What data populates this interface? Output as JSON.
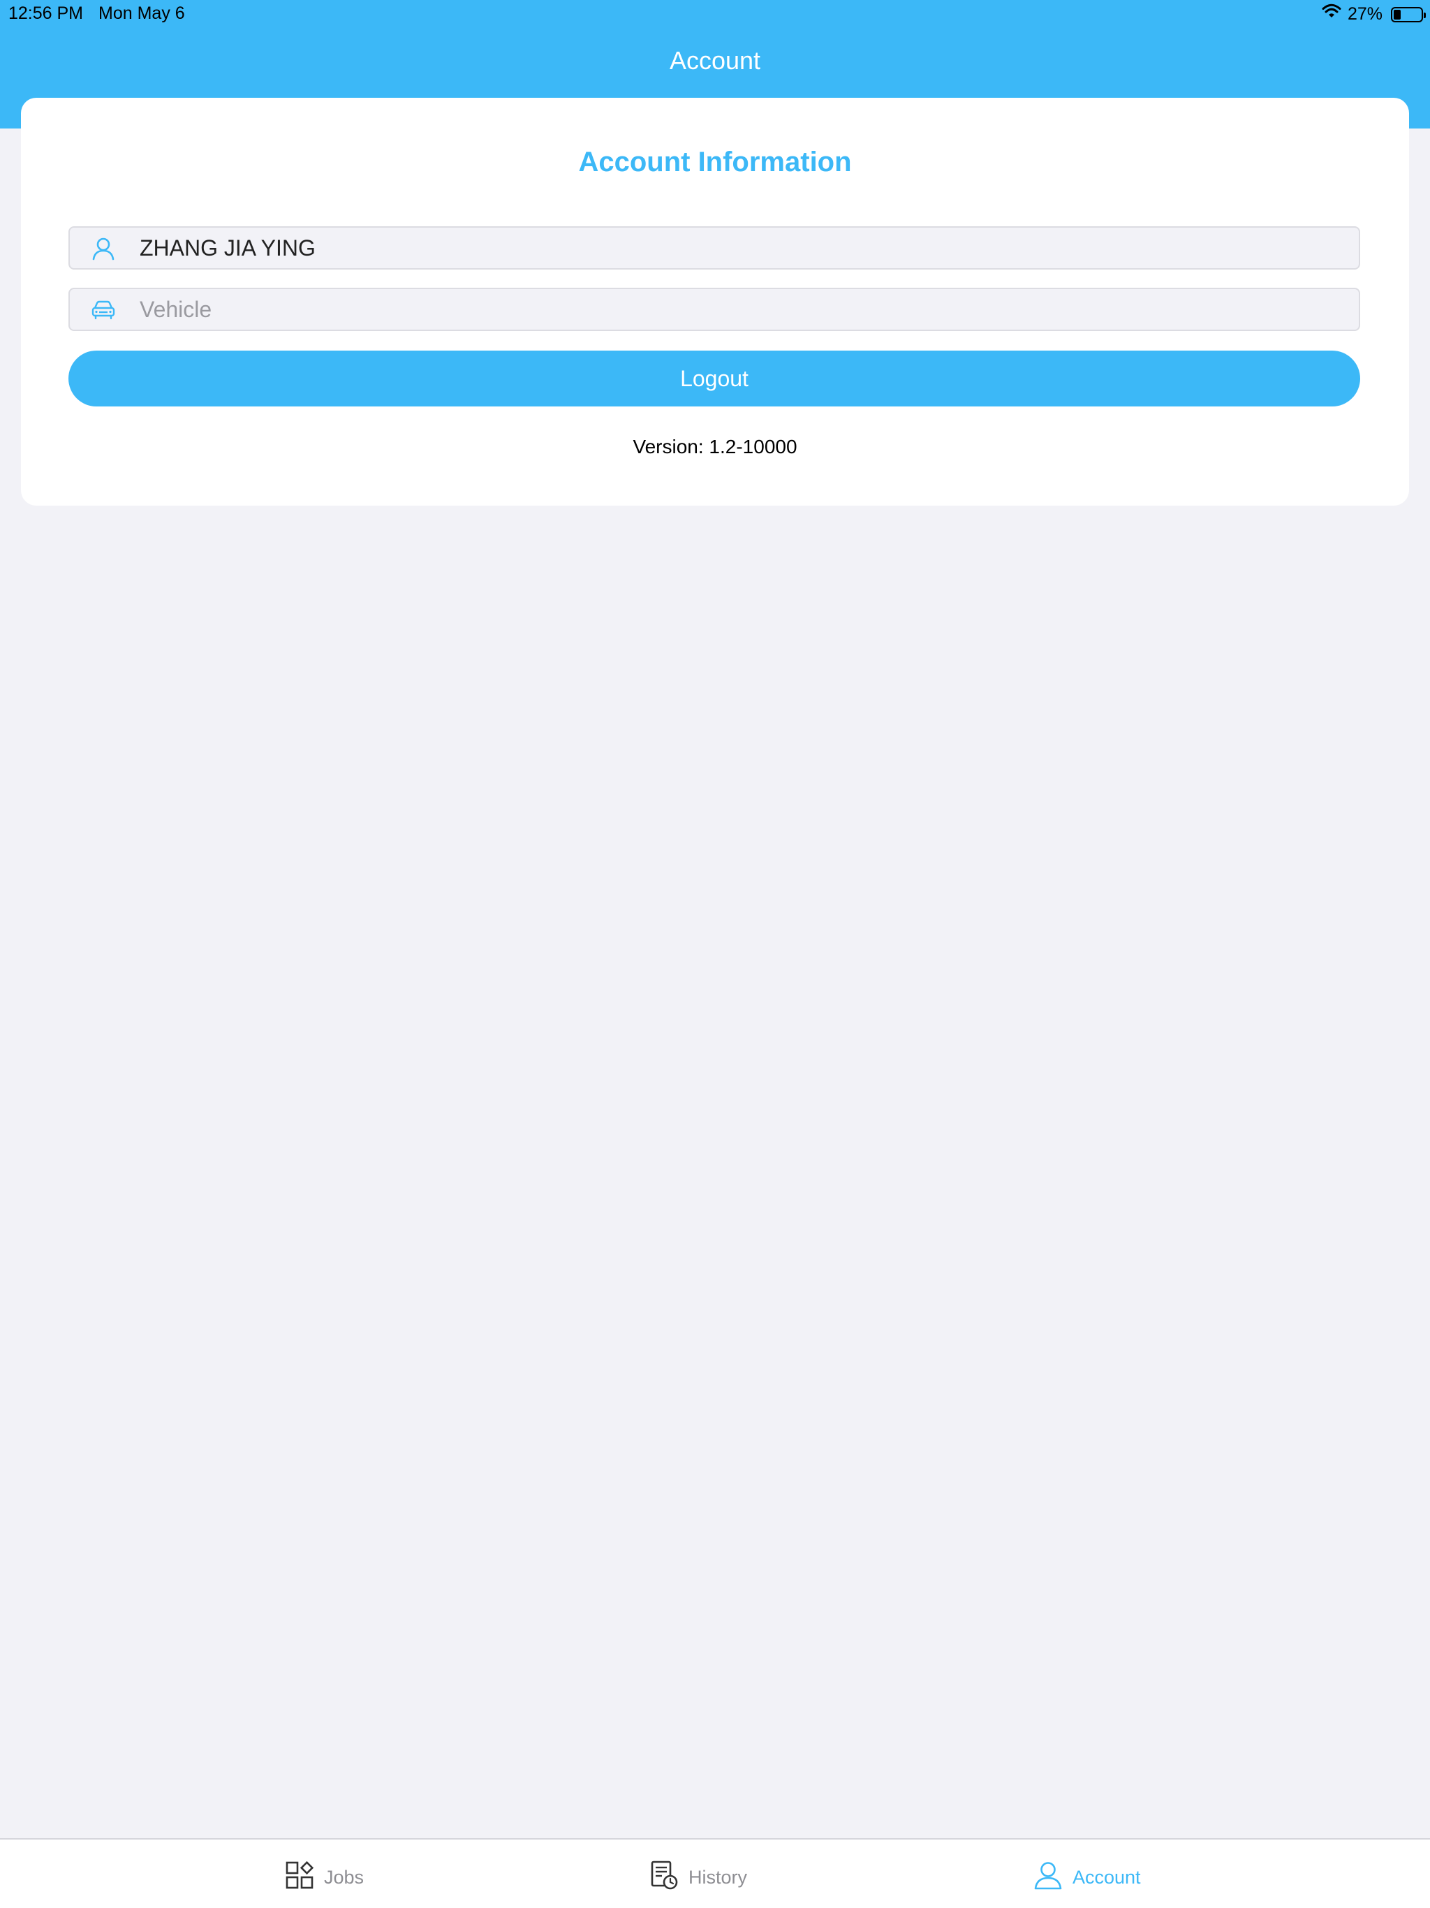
{
  "status_bar": {
    "time": "12:56 PM",
    "date": "Mon May 6",
    "battery_percent_label": "27%",
    "battery_level": 0.27
  },
  "navigation": {
    "title": "Account"
  },
  "account_card": {
    "title": "Account Information",
    "name_field": {
      "value": "ZHANG JIA YING",
      "icon": "user-icon"
    },
    "vehicle_field": {
      "value": "",
      "placeholder": "Vehicle",
      "icon": "car-icon"
    },
    "logout_label": "Logout",
    "version_text": "Version: 1.2-10000"
  },
  "tab_bar": {
    "items": [
      {
        "label": "Jobs",
        "icon": "grid-icon",
        "active": false
      },
      {
        "label": "History",
        "icon": "history-document-icon",
        "active": false
      },
      {
        "label": "Account",
        "icon": "user-icon",
        "active": true
      }
    ]
  },
  "colors": {
    "accent": "#3cb8f7",
    "background": "#f2f2f7",
    "inactive_tab": "#8e8e93"
  }
}
